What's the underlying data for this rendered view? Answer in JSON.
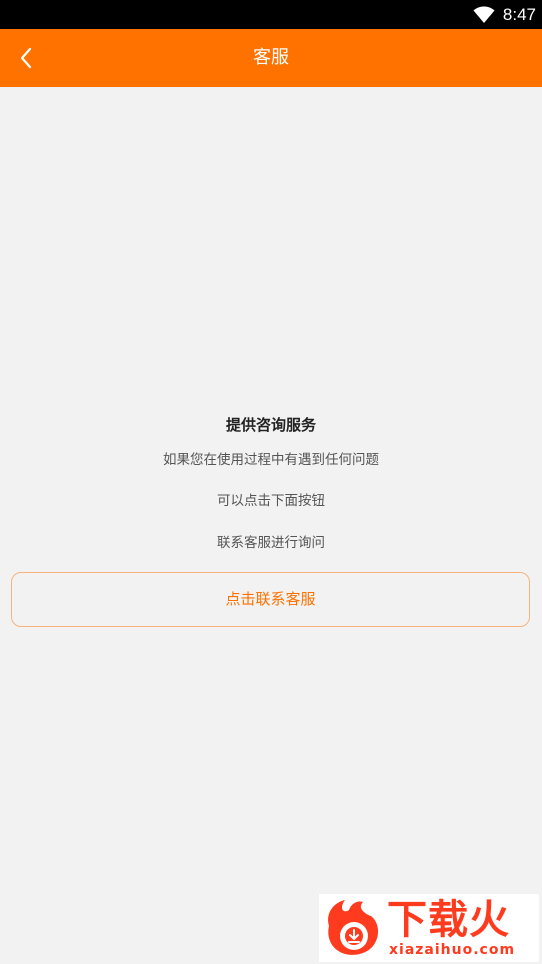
{
  "status_bar": {
    "time": "8:47",
    "wifi_icon": "wifi-icon"
  },
  "header": {
    "title": "客服",
    "back_icon": "chevron-left-icon",
    "background_color": "#ff7200"
  },
  "main": {
    "heading": "提供咨询服务",
    "lines": [
      "如果您在使用过程中有遇到任何问题",
      "可以点击下面按钮",
      "联系客服进行询问"
    ],
    "contact_button_label": "点击联系客服",
    "accent_color": "#ff7200"
  },
  "watermark": {
    "text_cn": "下载火",
    "url": "xiazaihuo.com"
  }
}
